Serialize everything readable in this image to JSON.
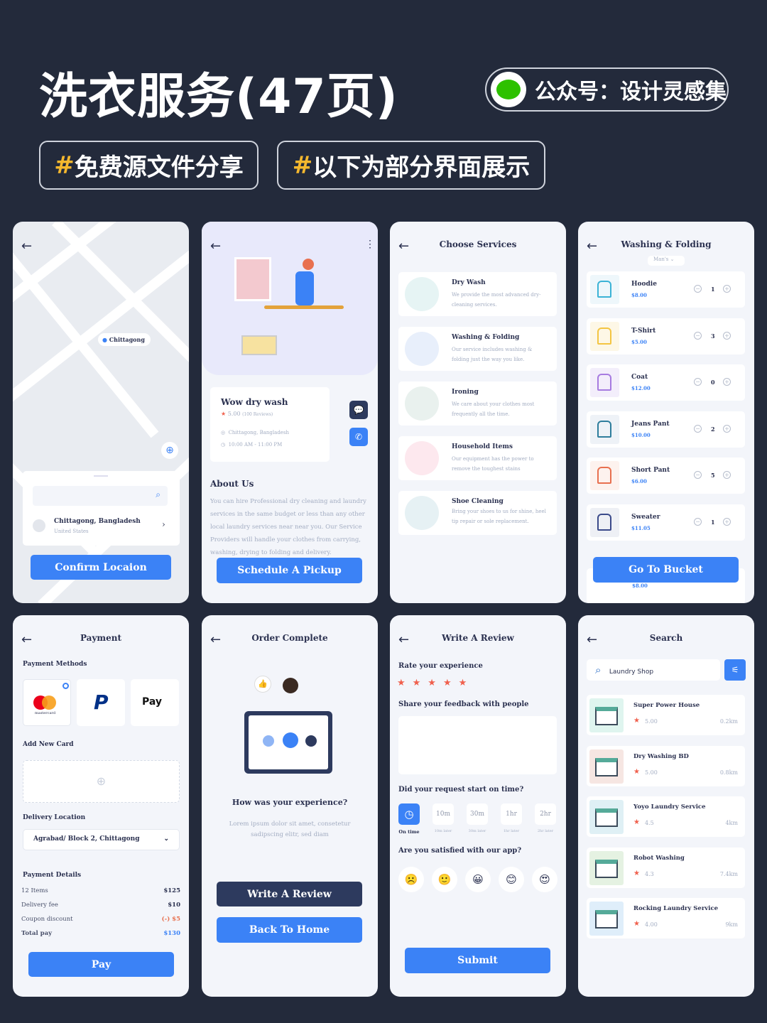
{
  "header": {
    "title": "洗衣服务(47页)",
    "account": "公众号：设计灵感集",
    "tags": [
      {
        "hash": "#",
        "text": "免费源文件分享"
      },
      {
        "hash": "#",
        "text": "以下为部分界面展示"
      }
    ]
  },
  "colors": {
    "background": "#232a3b",
    "accent": "#3b82f6",
    "dark_button": "#2d3a5e",
    "star": "#f0604d",
    "wechat": "#2dc100"
  },
  "map_screen": {
    "pin_label": "Chittagong",
    "location_title": "Chittagong, Bangladesh",
    "location_sub": "United States",
    "confirm": "Confirm Locaion"
  },
  "detail_screen": {
    "name": "Wow dry wash",
    "rating": "5.00",
    "reviews": "(100 Reviews)",
    "address": "Chittagong, Bangladesh",
    "hours": "10:00 AM - 11:00 PM",
    "about_title": "About Us",
    "about_text": "You can hire Professional dry cleaning and laundry services in the same budget or less than any other local laundry services near near you. Our Service Providers will handle your clothes from carrying, washing, drying to folding and delivery.",
    "schedule": "Schedule A Pickup"
  },
  "services_screen": {
    "title": "Choose Services",
    "items": [
      {
        "name": "Dry Wash",
        "desc": "We provide the most advanced dry-cleaning services.",
        "icon": "tshirt-basin-icon",
        "bg": "#e6f4f4"
      },
      {
        "name": "Washing & Folding",
        "desc": "Our service includes washing & folding just the way you like.",
        "icon": "washing-machine-icon",
        "bg": "#e8effb"
      },
      {
        "name": "Ironing",
        "desc": "We care about your clothes most frequently all the time.",
        "icon": "ironing-board-icon",
        "bg": "#e9f1ee"
      },
      {
        "name": "Household Items",
        "desc": "Our equipment has the power to remove the toughest stains",
        "icon": "towels-icon",
        "bg": "#fde8ee"
      },
      {
        "name": "Shoe Cleaning",
        "desc": "Bring your shoes to us for shine, heel tip repair or sole replacement.",
        "icon": "shoe-icon",
        "bg": "#e6f1f4"
      }
    ]
  },
  "folding_screen": {
    "title": "Washing & Folding",
    "filter": "Man's",
    "items": [
      {
        "name": "Hoodie",
        "price": "$8.00",
        "qty": "1",
        "icon": "hoodie-icon",
        "color": "#3bb3d6",
        "bg": "#eef7fb"
      },
      {
        "name": "T-Shirt",
        "price": "$5.00",
        "qty": "3",
        "icon": "tshirt-icon",
        "color": "#f4c542",
        "bg": "#fdf7e6"
      },
      {
        "name": "Coat",
        "price": "$12.00",
        "qty": "0",
        "icon": "coat-icon",
        "color": "#a77be0",
        "bg": "#f3eefb"
      },
      {
        "name": "Jeans Pant",
        "price": "$10.00",
        "qty": "2",
        "icon": "jeans-icon",
        "color": "#2e7d9c",
        "bg": "#eef2f7"
      },
      {
        "name": "Short Pant",
        "price": "$6.00",
        "qty": "5",
        "icon": "shorts-icon",
        "color": "#e8704f",
        "bg": "#fdf2ee"
      },
      {
        "name": "Sweater",
        "price": "$11.05",
        "qty": "1",
        "icon": "sweater-icon",
        "color": "#3b4a8a",
        "bg": "#eef0f5"
      }
    ],
    "partial_price": "$8.00",
    "cta": "Go To Bucket"
  },
  "payment_screen": {
    "title": "Payment",
    "methods_label": "Payment Methods",
    "methods": [
      "mastercard",
      "PayPal",
      "Pay"
    ],
    "add_card": "Add New Card",
    "delivery_label": "Delivery Location",
    "delivery_value": "Agrabad/ Block 2, Chittagong",
    "details_label": "Payment Details",
    "rows": [
      {
        "k": "12 Items",
        "v": "$125"
      },
      {
        "k": "Delivery fee",
        "v": "$10"
      },
      {
        "k": "Coupon discount",
        "v": "(-) $5"
      },
      {
        "k": "Total pay",
        "v": "$130"
      }
    ],
    "pay": "Pay"
  },
  "order_screen": {
    "title": "Order Complete",
    "question": "How was your experience?",
    "text": "Lorem ipsum dolor sit amet, consetetur sadipscing elitr, sed diam",
    "review": "Write A Review",
    "home": "Back To Home"
  },
  "review_screen": {
    "title": "Write A Review",
    "rate_label": "Rate your experience",
    "stars": 5,
    "feedback_label": "Share your feedback with people",
    "time_label": "Did your request start on time?",
    "times": [
      {
        "v": "",
        "l": "On time"
      },
      {
        "v": "10m",
        "l": "10m later"
      },
      {
        "v": "30m",
        "l": "30m later"
      },
      {
        "v": "1hr",
        "l": "1hr later"
      },
      {
        "v": "2hr",
        "l": "2hr later"
      }
    ],
    "satisfied_label": "Are you satisfied with our app?",
    "emojis": [
      "☹️",
      "🙂",
      "😀",
      "😊",
      "😍"
    ],
    "submit": "Submit"
  },
  "search_screen": {
    "title": "Search",
    "query": "Laundry Shop",
    "results": [
      {
        "name": "Super Power House",
        "rating": "5.00",
        "dist": "0.2km",
        "bg": "#dff5ef"
      },
      {
        "name": "Dry Washing BD",
        "rating": "5.00",
        "dist": "0.8km",
        "bg": "#f6e6e2"
      },
      {
        "name": "Yoyo Laundry Service",
        "rating": "4.5",
        "dist": "4km",
        "bg": "#dff0f5"
      },
      {
        "name": "Robot Washing",
        "rating": "4.3",
        "dist": "7.4km",
        "bg": "#e5f2e2"
      },
      {
        "name": "Rocking Laundry Service",
        "rating": "4.00",
        "dist": "9km",
        "bg": "#dfeefa"
      }
    ]
  }
}
